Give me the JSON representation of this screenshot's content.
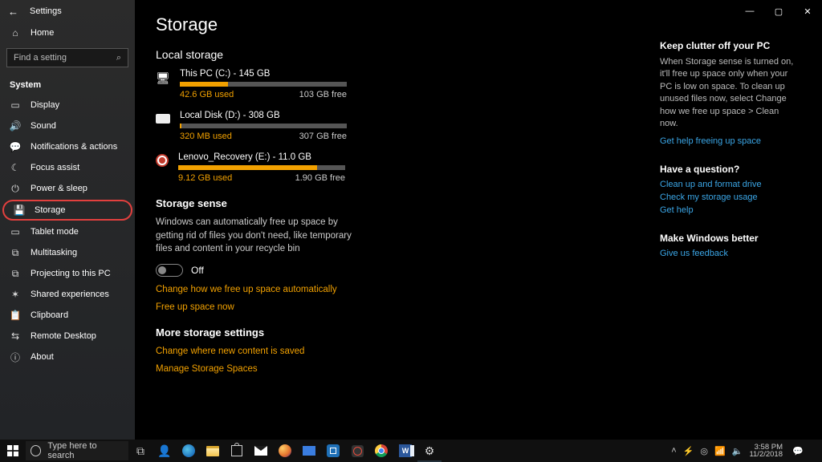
{
  "window": {
    "app": "Settings",
    "min": "—",
    "max": "▢",
    "close": "✕"
  },
  "sidebar": {
    "home": "Home",
    "search_placeholder": "Find a setting",
    "section": "System",
    "items": [
      {
        "icon": "▭",
        "label": "Display"
      },
      {
        "icon": "🔊",
        "label": "Sound"
      },
      {
        "icon": "💬",
        "label": "Notifications & actions"
      },
      {
        "icon": "☾",
        "label": "Focus assist"
      },
      {
        "icon": "⏻",
        "label": "Power & sleep"
      },
      {
        "icon": "💾",
        "label": "Storage"
      },
      {
        "icon": "▭",
        "label": "Tablet mode"
      },
      {
        "icon": "⧉",
        "label": "Multitasking"
      },
      {
        "icon": "⧉",
        "label": "Projecting to this PC"
      },
      {
        "icon": "✶",
        "label": "Shared experiences"
      },
      {
        "icon": "📋",
        "label": "Clipboard"
      },
      {
        "icon": "⇆",
        "label": "Remote Desktop"
      },
      {
        "icon": "ⓘ",
        "label": "About"
      }
    ]
  },
  "page": {
    "title": "Storage",
    "local_heading": "Local storage",
    "drives": [
      {
        "name": "This PC (C:) - 145 GB",
        "used": "42.6 GB used",
        "free": "103 GB free",
        "fill": 29,
        "icon": "pc"
      },
      {
        "name": "Local Disk (D:) - 308 GB",
        "used": "320 MB used",
        "free": "307 GB free",
        "fill": 1,
        "icon": "hdd"
      },
      {
        "name": "Lenovo_Recovery (E:) - 11.0 GB",
        "used": "9.12 GB used",
        "free": "1.90 GB free",
        "fill": 83,
        "icon": "rec"
      }
    ],
    "sense_heading": "Storage sense",
    "sense_body": "Windows can automatically free up space by getting rid of files you don't need, like temporary files and content in your recycle bin",
    "toggle_label": "Off",
    "link_auto": "Change how we free up space automatically",
    "link_free": "Free up space now",
    "more_heading": "More storage settings",
    "link_where": "Change where new content is saved",
    "link_spaces": "Manage Storage Spaces"
  },
  "right": {
    "tip_h": "Keep clutter off your PC",
    "tip_body": "When Storage sense is turned on, it'll free up space only when your PC is low on space. To clean up unused files now, select Change how we free up space > Clean now.",
    "tip_link": "Get help freeing up space",
    "q_h": "Have a question?",
    "q_links": [
      "Clean up and format drive",
      "Check my storage usage",
      "Get help"
    ],
    "fb_h": "Make Windows better",
    "fb_link": "Give us feedback"
  },
  "taskbar": {
    "search_placeholder": "Type here to search",
    "time": "3:58 PM",
    "date": "11/2/2018"
  }
}
